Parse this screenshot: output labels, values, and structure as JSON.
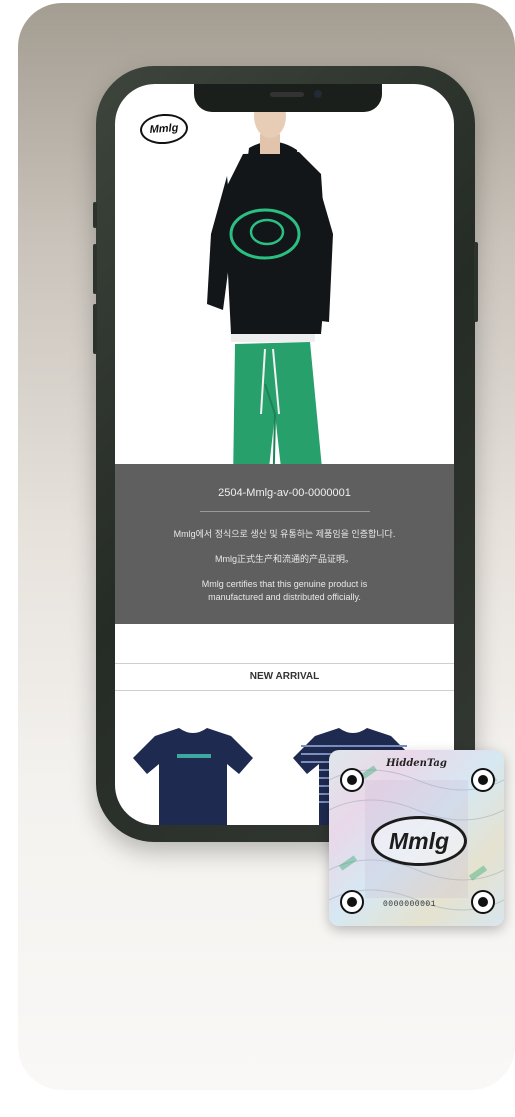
{
  "brand": {
    "logo_text": "Mmlg"
  },
  "product_info": {
    "serial": "2504-Mmlg-av-00-0000001",
    "line_ko": "Mmlg에서 정식으로 생산 및 유통하는 제품임을 인증합니다.",
    "line_zh": "Mmlg正式生产和流通的产品证明。",
    "line_en": "Mmlg certifies that this genuine product is manufactured and distributed officially."
  },
  "section": {
    "new_arrival": "NEW ARRIVAL"
  },
  "tag": {
    "brand": "HiddenTag",
    "logo_text": "Mmlg",
    "serial": "0000000001"
  },
  "colors": {
    "hoodie": "#121619",
    "pants": "#27a06c",
    "beanie": "#9aa0a5",
    "info_overlay": "#5f5f5f",
    "tee_navy": "#1e2a4f",
    "phone_frame": "#2f362f"
  }
}
